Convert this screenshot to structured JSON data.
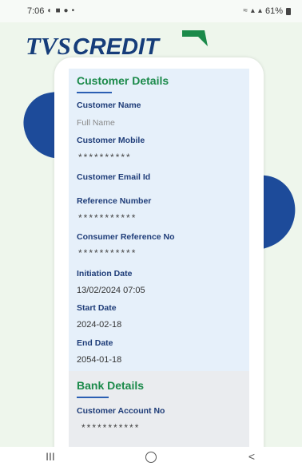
{
  "status_bar": {
    "time": "7:06",
    "battery_percent": "61%"
  },
  "brand": {
    "tvs": "TVS",
    "credit": "CREDIT",
    "flag_color": "#1b8a4a"
  },
  "customer_details": {
    "title": "Customer Details",
    "customer_name_label": "Customer Name",
    "customer_name_placeholder": "Full Name",
    "customer_mobile_label": "Customer Mobile",
    "customer_mobile_value": "**********",
    "customer_email_label": "Customer Email Id",
    "reference_number_label": "Reference Number",
    "reference_number_value": "***********",
    "consumer_reference_label": "Consumer Reference No",
    "consumer_reference_value": "***********",
    "initiation_date_label": "Initiation Date",
    "initiation_date_value": "13/02/2024 07:05",
    "start_date_label": "Start Date",
    "start_date_value": "2024-02-18",
    "end_date_label": "End Date",
    "end_date_value": "2054-01-18"
  },
  "bank_details": {
    "title": "Bank Details",
    "customer_account_label": "Customer Account No",
    "customer_account_value": "***********"
  },
  "nav_bar": {
    "recents": "III",
    "back": "<"
  },
  "colors": {
    "brand_blue": "#163d7a",
    "accent_green": "#1b8a4a",
    "label_blue": "#1e3c78",
    "panel_bg": "#e6f0fa"
  }
}
